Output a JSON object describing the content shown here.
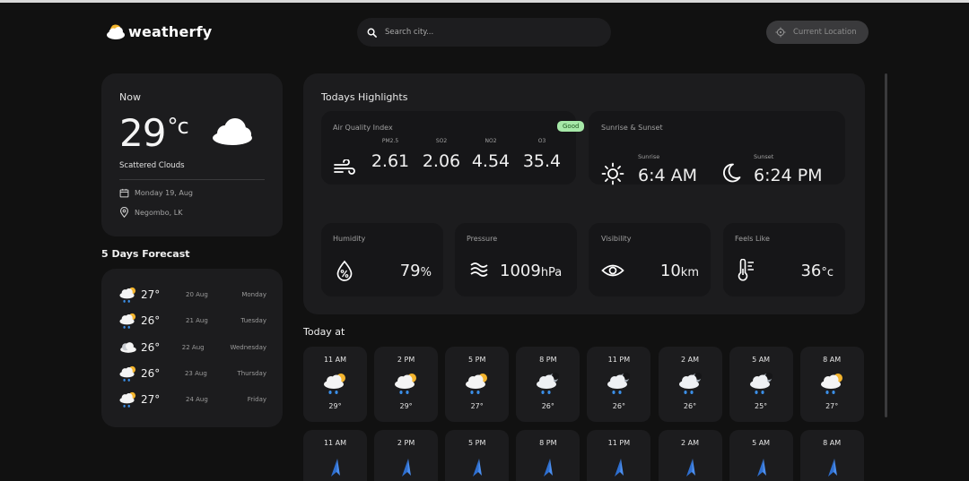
{
  "brand": {
    "name": "weatherfy",
    "icon": "cloud-sun-icon"
  },
  "search": {
    "placeholder": "Search city..."
  },
  "location_button": {
    "label": "Current Location",
    "icon": "crosshair-icon"
  },
  "now": {
    "label": "Now",
    "temp": "29",
    "unit": "°c",
    "description": "Scattered Clouds",
    "date": "Monday 19, Aug",
    "location": "Negombo, LK",
    "icon": "cloud-icon"
  },
  "forecast": {
    "title": "5 Days Forecast",
    "days": [
      {
        "temp": "27°",
        "date": "20 Aug",
        "day": "Monday",
        "icon": "rain-sun-icon"
      },
      {
        "temp": "26°",
        "date": "21 Aug",
        "day": "Tuesday",
        "icon": "rain-sun-icon"
      },
      {
        "temp": "26°",
        "date": "22 Aug",
        "day": "Wednesday",
        "icon": "cloud-icon"
      },
      {
        "temp": "26°",
        "date": "23 Aug",
        "day": "Thursday",
        "icon": "rain-sun-icon"
      },
      {
        "temp": "27°",
        "date": "24 Aug",
        "day": "Friday",
        "icon": "rain-sun-icon"
      }
    ]
  },
  "highlights": {
    "title": "Todays Highlights",
    "aqi": {
      "label": "Air Quality Index",
      "badge": "Good",
      "items": [
        {
          "name": "PM2.5",
          "value": "2.61"
        },
        {
          "name": "SO2",
          "value": "2.06"
        },
        {
          "name": "NO2",
          "value": "4.54"
        },
        {
          "name": "O3",
          "value": "35.4"
        }
      ]
    },
    "sun": {
      "label": "Sunrise & Sunset",
      "sunrise_label": "Sunrise",
      "sunrise": "6:4 AM",
      "sunset_label": "Sunset",
      "sunset": "6:24 PM"
    },
    "humidity": {
      "label": "Humidity",
      "value": "79",
      "unit": "%"
    },
    "pressure": {
      "label": "Pressure",
      "value": "1009",
      "unit": "hPa"
    },
    "visibility": {
      "label": "Visibility",
      "value": "10",
      "unit": "km"
    },
    "feels_like": {
      "label": "Feels Like",
      "value": "36",
      "unit": "°c"
    }
  },
  "today": {
    "title": "Today at",
    "hours": [
      {
        "time": "11 AM",
        "temp": "29°",
        "icon": "rain-sun-icon"
      },
      {
        "time": "2 PM",
        "temp": "29°",
        "icon": "rain-sun-icon"
      },
      {
        "time": "5 PM",
        "temp": "27°",
        "icon": "rain-sun-icon"
      },
      {
        "time": "8 PM",
        "temp": "26°",
        "icon": "rain-moon-icon"
      },
      {
        "time": "11 PM",
        "temp": "26°",
        "icon": "rain-moon-icon"
      },
      {
        "time": "2 AM",
        "temp": "26°",
        "icon": "rain-moon-icon"
      },
      {
        "time": "5 AM",
        "temp": "25°",
        "icon": "rain-moon-icon"
      },
      {
        "time": "8 AM",
        "temp": "27°",
        "icon": "rain-sun-icon"
      }
    ],
    "wind_hours": [
      "11 AM",
      "2 PM",
      "5 PM",
      "8 PM",
      "11 PM",
      "2 AM",
      "5 AM",
      "8 AM"
    ]
  },
  "colors": {
    "background": "#111111",
    "card": "#1c1c1e",
    "inner_card": "#161618",
    "badge_good": "#a6e8a8",
    "accent_blue": "#3a7bd5"
  }
}
